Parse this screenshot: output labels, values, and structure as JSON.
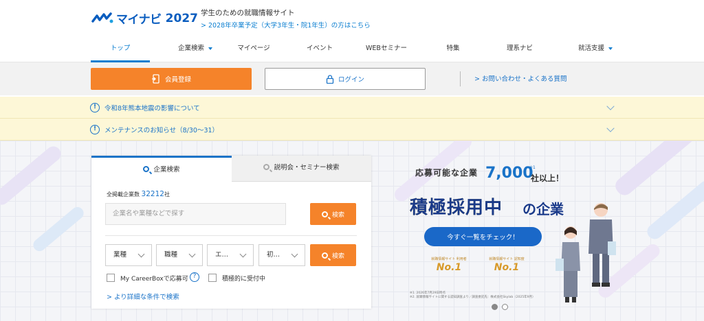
{
  "header": {
    "logo_text": "マイナビ",
    "logo_year": "2027",
    "tagline": "学生のための就職情報サイト",
    "grad_link": "> 2028年卒業予定（大学3年生・院1年生）の方はこちら"
  },
  "nav": {
    "items": [
      {
        "label": "トップ"
      },
      {
        "label": "企業検索"
      },
      {
        "label": "マイページ"
      },
      {
        "label": "イベント"
      },
      {
        "label": "WEBセミナー"
      },
      {
        "label": "特集"
      },
      {
        "label": "理系ナビ"
      },
      {
        "label": "就活支援"
      }
    ]
  },
  "actions": {
    "register_label": "会員登録",
    "login_label": "ログイン",
    "help_link": "> お問い合わせ・よくある質問"
  },
  "notices": [
    {
      "text": "令和8年熊本地震の影響について"
    },
    {
      "text": "メンテナンスのお知らせ（8/30〜31）"
    }
  ],
  "search": {
    "tab_company": "企業検索",
    "tab_seminar": "説明会・セミナー検索",
    "count_label": "全掲載企業数",
    "count_value": "32212",
    "count_unit": "社",
    "keyword_placeholder": "企業名や業種などで探す",
    "search_label": "検索",
    "selects": [
      {
        "label": "業種"
      },
      {
        "label": "職種"
      },
      {
        "label": "エ…"
      },
      {
        "label": "初…"
      }
    ],
    "checkbox_careerbox": "My CareerBoxで応募可",
    "checkbox_active": "積極的に受付中",
    "more_conditions": "> より詳細な条件で検索"
  },
  "promo": {
    "line1": "応募可能な企業",
    "count": "7,000",
    "note_mark": "※1",
    "line1_suffix": "社以上！",
    "headline": "積極採用中",
    "headline_suffix": "の企業",
    "cta": "今すぐ一覧をチェック！",
    "awards": [
      {
        "caption": "就職情報サイト 利用者",
        "rank": "No.1"
      },
      {
        "caption": "就職情報サイト 認知度",
        "rank": "No.1"
      }
    ],
    "footnote1": "※1. 2026年7月29日時点",
    "footnote2": "※2. 就職情報サイトに関する認知調査より／調査委託先：株式会社Skylab（2025年9月）"
  },
  "colors": {
    "brand_blue": "#1a73c8",
    "orange": "#f5832a",
    "notice_bg": "#fdf7d7"
  }
}
